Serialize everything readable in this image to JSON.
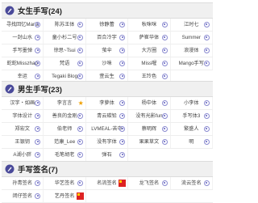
{
  "sections": [
    {
      "title": "女生手写(24)",
      "items": [
        "寻找回忆Mariana",
        "陈苏王体",
        "徐静蕾",
        "秋咪咪",
        "江时七",
        "一封山水",
        "童小杉二号",
        "百合冷字",
        "萨崔华体",
        "Summer",
        "手写墨弹",
        "徐思~Tsui",
        "萤伞",
        "大方圈",
        "浪漫体",
        "蛇蛇Misszhao",
        "梵语",
        "沙咪",
        "Miss喔",
        "Mango手写",
        "幸运",
        "Tegaki Blog",
        "萱云生",
        "王玲色"
      ]
    },
    {
      "title": "男生手写(23)",
      "items": [
        "汉字・如画",
        "李言言",
        "李萝体",
        "杨中体",
        "小李体",
        "字体设计",
        "善良的金刚",
        "青云碳铅",
        "没有光影fun",
        "手写体3",
        "郑宏文",
        "伯老师",
        "LVMEAL-苦中",
        "蔡明辉",
        "繁盛人",
        "王银钥",
        "范康_Lee",
        "没有字体",
        "果果草文",
        "明",
        "",
        "A湖小胖",
        "毛笔胡老",
        "弹石"
      ]
    },
    {
      "title": "手写签名(7)",
      "items": [
        "孙青签名",
        "华艺签名",
        "名流签名",
        "龙飞签名",
        "流云签名",
        "闭仔签名",
        "艺丹签名"
      ]
    }
  ],
  "colors": {
    "pick": "#8a8ad0",
    "header_bg": "#f0f0f0",
    "header_icon": "#4a4a9a"
  }
}
